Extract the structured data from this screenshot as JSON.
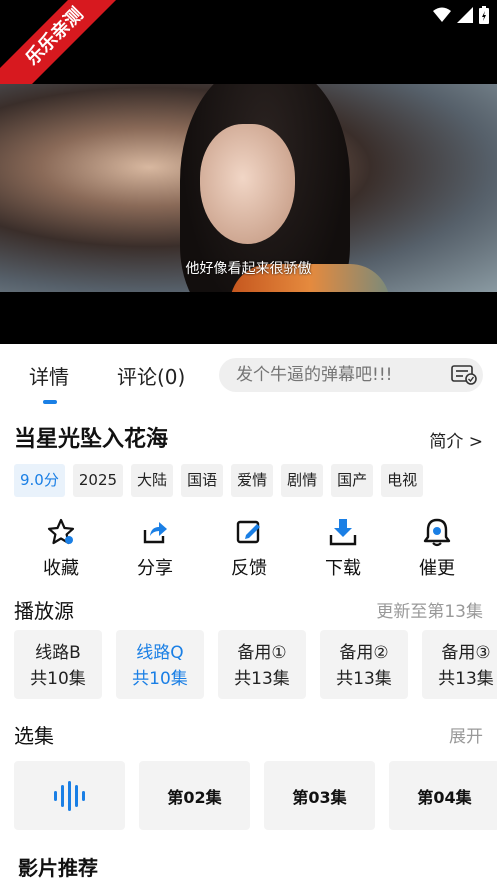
{
  "watermark": "乐乐亲测",
  "video": {
    "subtitle": "他好像看起来很骄傲"
  },
  "tabs": [
    {
      "label": "详情"
    },
    {
      "label": "评论(0)"
    }
  ],
  "danmu": {
    "placeholder": "发个牛逼的弹幕吧!!!"
  },
  "show": {
    "title": "当星光坠入花海",
    "intro_link": "简介 >"
  },
  "tags": [
    "9.0分",
    "2025",
    "大陆",
    "国语",
    "爱情",
    "剧情",
    "国产",
    "电视"
  ],
  "actions": [
    {
      "label": "收藏",
      "icon": "star-icon"
    },
    {
      "label": "分享",
      "icon": "share-icon"
    },
    {
      "label": "反馈",
      "icon": "edit-icon"
    },
    {
      "label": "下载",
      "icon": "download-icon"
    },
    {
      "label": "催更",
      "icon": "bell-icon"
    }
  ],
  "sources_section": {
    "title": "播放源",
    "update": "更新至第13集"
  },
  "sources": [
    {
      "name": "线路B",
      "count": "共10集"
    },
    {
      "name": "线路Q",
      "count": "共10集"
    },
    {
      "name": "备用①",
      "count": "共13集"
    },
    {
      "name": "备用②",
      "count": "共13集"
    },
    {
      "name": "备用③",
      "count": "共13集"
    }
  ],
  "episodes_section": {
    "title": "选集",
    "expand": "展开"
  },
  "episodes": [
    "第02集",
    "第03集",
    "第04集"
  ],
  "recommend": {
    "title": "影片推荐"
  },
  "colors": {
    "accent": "#1a7fe5",
    "ribbon": "#d7191f"
  }
}
